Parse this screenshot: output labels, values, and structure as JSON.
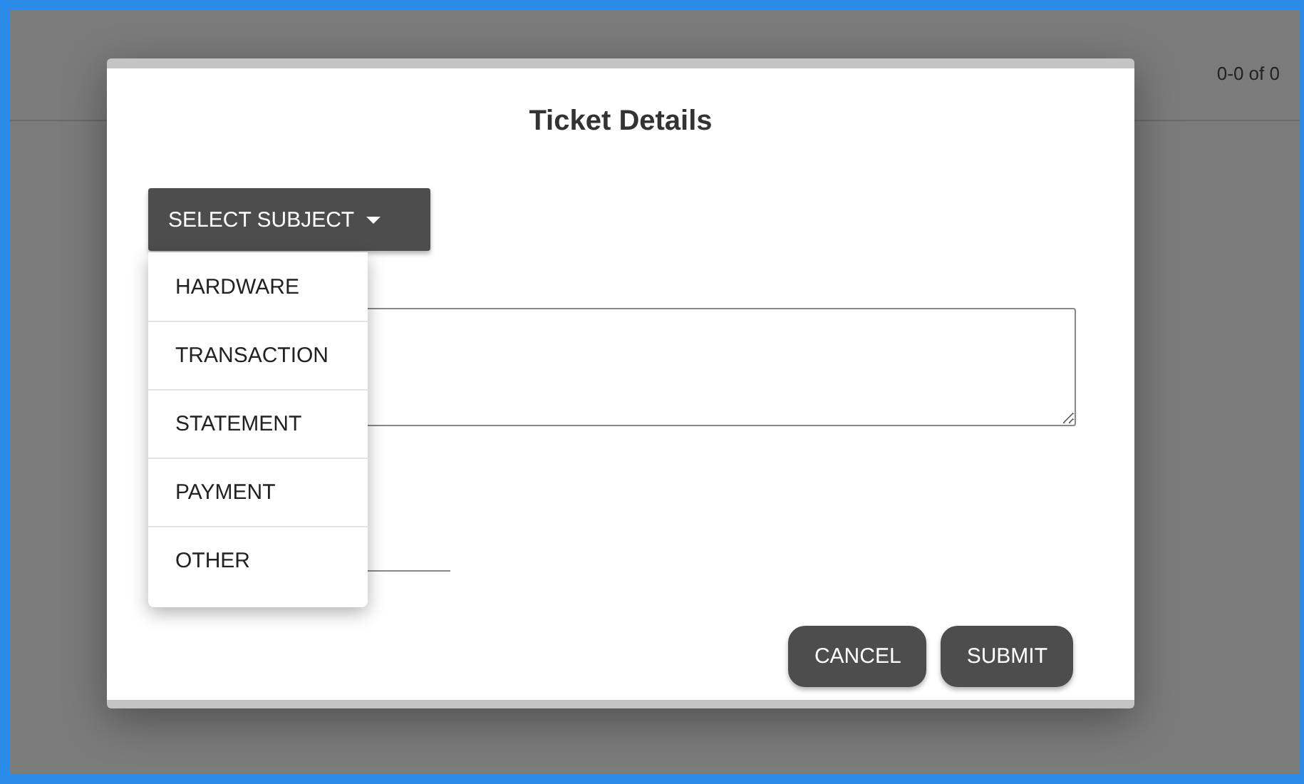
{
  "background": {
    "pagination": "0-0 of 0"
  },
  "dialog": {
    "title": "Ticket Details",
    "subject_button": {
      "label": "SELECT SUBJECT",
      "expanded": true
    },
    "subject_menu": [
      {
        "label": "HARDWARE",
        "selected": false
      },
      {
        "label": "TRANSACTION",
        "selected": false
      },
      {
        "label": "STATEMENT",
        "selected": false
      },
      {
        "label": "PAYMENT",
        "selected": false
      },
      {
        "label": "OTHER",
        "selected": false
      }
    ],
    "buttons": [
      {
        "label": "CANCEL"
      },
      {
        "label": "SUBMIT"
      }
    ]
  }
}
